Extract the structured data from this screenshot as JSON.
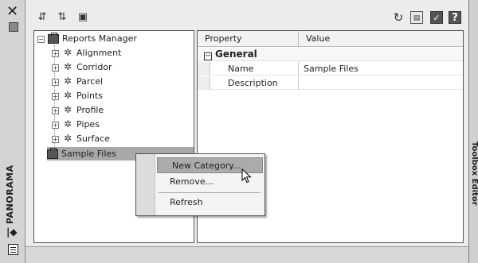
{
  "palette": {
    "panel_bg": "#ffffff",
    "highlight": "#a8a8a8",
    "chrome": "#d4d4d4"
  },
  "window": {
    "strip_label": "PANORAMA"
  },
  "tree": {
    "root": "Reports Manager",
    "children": [
      "Alignment",
      "Corridor",
      "Parcel",
      "Points",
      "Profile",
      "Pipes",
      "Surface"
    ],
    "sample": "Sample Files"
  },
  "properties": {
    "headers": {
      "property": "Property",
      "value": "Value"
    },
    "group": "General",
    "rows": [
      {
        "name": "Name",
        "value": "Sample Files"
      },
      {
        "name": "Description",
        "value": ""
      }
    ]
  },
  "context_menu": {
    "new_category": "New Category...",
    "remove": "Remove...",
    "refresh": "Refresh"
  },
  "side_tabs": [
    "Toolbox Editor"
  ],
  "icons": [
    "close-icon",
    "refresh-icon",
    "save-icon",
    "check-icon",
    "help-icon",
    "gear-icon",
    "reports-manager-icon"
  ]
}
